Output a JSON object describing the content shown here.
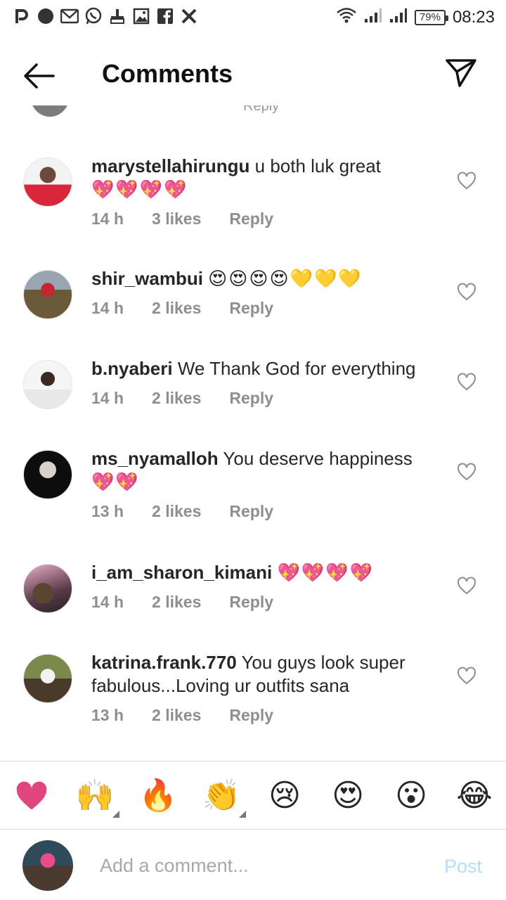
{
  "status_bar": {
    "time": "08:23",
    "battery": "79%",
    "left_icons": [
      "pinterest-icon",
      "dot-icon",
      "gmail-icon",
      "whatsapp-icon",
      "cleaner-icon",
      "gallery-icon",
      "facebook-icon",
      "x-icon"
    ],
    "right_icons": [
      "wifi-icon",
      "signal-icon",
      "signal-icon"
    ]
  },
  "header": {
    "title": "Comments",
    "back_icon": "arrow-left-icon",
    "share_icon": "send-icon"
  },
  "hidden_row": {
    "reply": "Reply"
  },
  "comments": [
    {
      "username": "marystellahirungu",
      "text": "u both luk great",
      "emoji": "💖💖💖💖",
      "time": "14 h",
      "likes": "3 likes",
      "reply": "Reply"
    },
    {
      "username": "shir_wambui",
      "text": "",
      "emoji": "😍😍😍😍💛💛💛",
      "time": "14 h",
      "likes": "2 likes",
      "reply": "Reply"
    },
    {
      "username": "b.nyaberi",
      "text": "We Thank God for everything",
      "emoji": "",
      "time": "14 h",
      "likes": "2 likes",
      "reply": "Reply"
    },
    {
      "username": "ms_nyamalloh",
      "text": "You deserve happiness",
      "emoji": "💖💖",
      "time": "13 h",
      "likes": "2 likes",
      "reply": "Reply"
    },
    {
      "username": "i_am_sharon_kimani",
      "text": "",
      "emoji": "💖💖💖💖",
      "time": "14 h",
      "likes": "2 likes",
      "reply": "Reply"
    },
    {
      "username": "katrina.frank.770",
      "text": "You guys look super fabulous...Loving ur outfits sana",
      "emoji": "",
      "time": "13 h",
      "likes": "2 likes",
      "reply": "Reply"
    }
  ],
  "emoji_bar": [
    "❤️",
    "🙌",
    "🔥",
    "👏",
    "😢",
    "😍",
    "😮",
    "😂"
  ],
  "composer": {
    "placeholder": "Add a comment...",
    "post_label": "Post"
  },
  "colors": {
    "heart_pink": "#e0457b",
    "post_disabled": "#b2dffc",
    "meta_gray": "#8e8e8e"
  }
}
